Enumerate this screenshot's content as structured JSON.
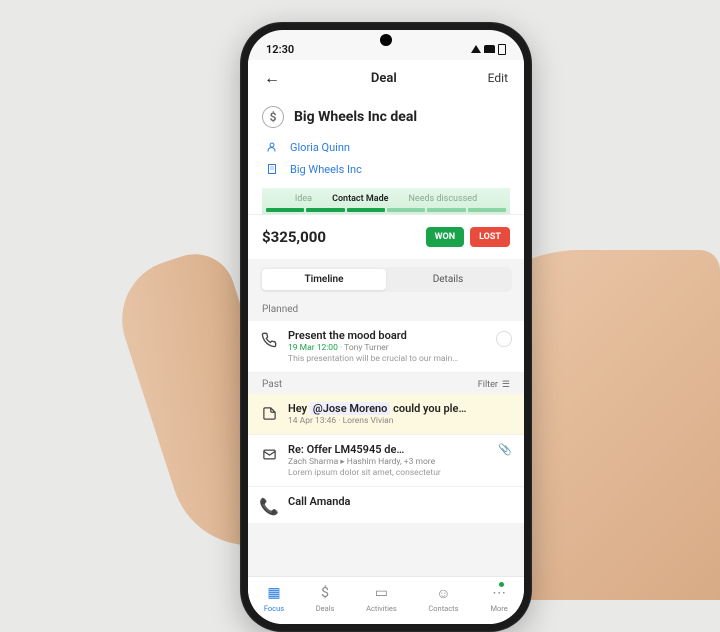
{
  "statusbar": {
    "time": "12:30"
  },
  "nav": {
    "title": "Deal",
    "edit": "Edit"
  },
  "deal": {
    "title": "Big Wheels Inc deal",
    "contact": "Gloria Quinn",
    "org": "Big Wheels Inc",
    "value": "$325,000"
  },
  "stages": {
    "prev": "Idea",
    "current": "Contact Made",
    "next": "Needs discussed"
  },
  "buttons": {
    "won": "WON",
    "lost": "LOST"
  },
  "tabs": {
    "timeline": "Timeline",
    "details": "Details"
  },
  "sections": {
    "planned": "Planned",
    "past": "Past",
    "filter": "Filter"
  },
  "planned": {
    "title": "Present the mood board",
    "datetime": "19 Mar 12:00",
    "owner": "Tony Turner",
    "desc": "This presentation will be crucial to our main…"
  },
  "past": {
    "note_prefix": "Hey ",
    "note_mention": "@Jose Moreno",
    "note_suffix": " could you ple…",
    "note_meta": "14 Apr 13:46 · Lorens Vivian",
    "email_title": "Re: Offer LM45945 de…",
    "email_meta": "Zach Sharma ▸ Hashim Hardy, +3 more",
    "email_desc": "Lorem ipsum dolor sit amet, consectetur",
    "call_title": "Call Amanda"
  },
  "tabbar": {
    "focus": "Focus",
    "deals": "Deals",
    "activities": "Activities",
    "contacts": "Contacts",
    "more": "More"
  }
}
